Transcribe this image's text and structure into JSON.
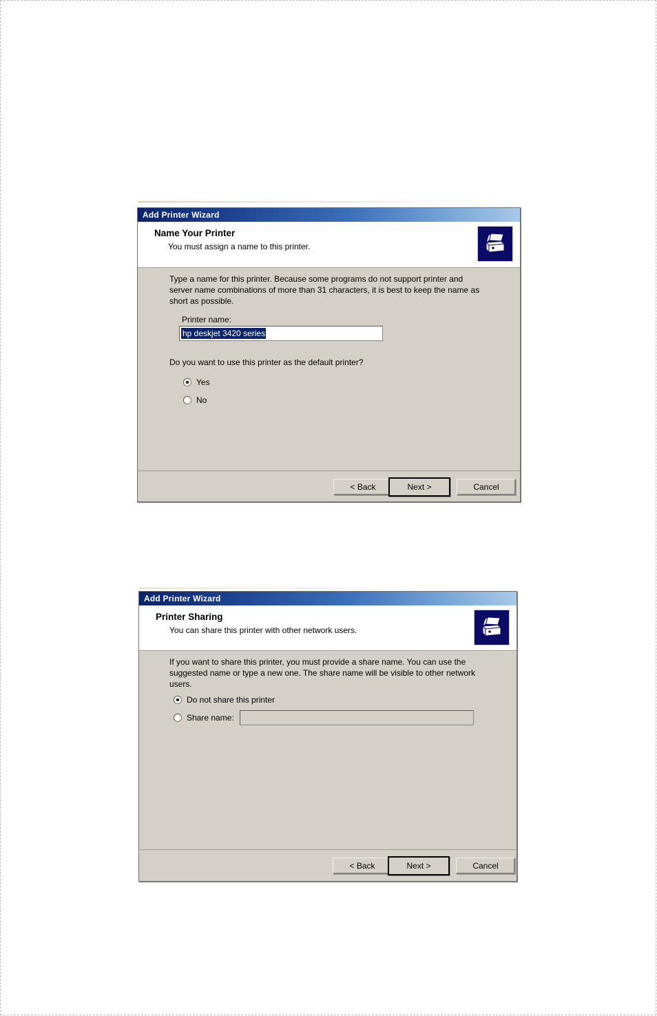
{
  "page": {
    "background": "#ffffff"
  },
  "dialogs": [
    {
      "id": "name-your-printer",
      "titlebar": "Add Printer Wizard",
      "header": {
        "title": "Name Your Printer",
        "subtitle": "You must assign a name to this printer.",
        "icon": "printer-icon"
      },
      "body": {
        "paragraph": "Type a name for this printer. Because some programs do not support printer and server name combinations of more than 31 characters, it is best to keep the name as short as possible.",
        "printer_name_label": "Printer name:",
        "printer_name_value": "hp deskjet 3420 series",
        "printer_name_selected": true,
        "default_printer_question": "Do you want to use this printer as the default printer?",
        "options": [
          {
            "label": "Yes",
            "checked": true
          },
          {
            "label": "No",
            "checked": false
          }
        ]
      },
      "buttons": {
        "back": "< Back",
        "next": "Next >",
        "cancel": "Cancel",
        "default": "next"
      }
    },
    {
      "id": "printer-sharing",
      "titlebar": "Add Printer Wizard",
      "header": {
        "title": "Printer Sharing",
        "subtitle": "You can share this printer with other network users.",
        "icon": "printer-icon"
      },
      "body": {
        "paragraph": "If you want to share this printer, you must provide a share name. You can use the suggested name or type a new one. The share name will be visible to other network users.",
        "options": [
          {
            "label": "Do not share this printer",
            "checked": true
          },
          {
            "label": "Share name:",
            "checked": false
          }
        ],
        "share_name_value": "",
        "share_name_disabled": true
      },
      "buttons": {
        "back": "< Back",
        "next": "Next >",
        "cancel": "Cancel",
        "default": "next"
      }
    }
  ],
  "colors": {
    "titlebar_start": "#0a246a",
    "titlebar_end": "#a8c8e8",
    "dialog_face": "#d4d0c8",
    "selection": "#0a246a",
    "icon_background": "#0b0b66"
  }
}
